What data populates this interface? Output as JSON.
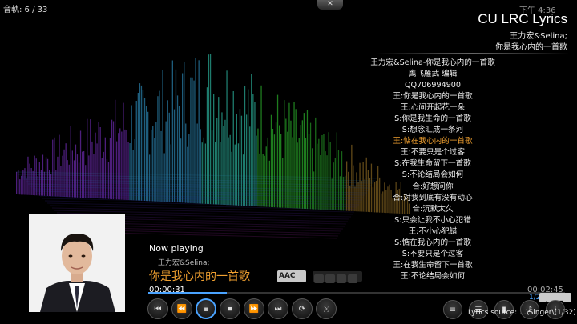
{
  "player": {
    "track_counter": "音軌: 6 / 33",
    "clock": "下午 4:36",
    "close_glyph": "✕"
  },
  "lyrics_panel": {
    "title": "CU LRC Lyrics",
    "artist": "王力宏&Selina;",
    "song": "你是我心内的一首歌",
    "lines": [
      "王力宏&Selina-你是我心内的一首歌",
      "鹰飞雁武 编辑",
      "QQ706994900",
      "王:你是我心内的一首歌",
      "王:心间开起花一朵",
      "S:你是我生命的一首歌",
      "S:想念汇成一条河",
      "王:惦在我心内的一首歌",
      "王:不要只是个过客",
      "S:在我生命留下一首歌",
      "S:不论结局会如何",
      "合:好想问你",
      "合:对我到底有没有动心",
      "合:沉默太久",
      "S:只会让我不小心犯错",
      "王:不小心犯错",
      "S:惦在我心内的一首歌",
      "S:不要只是个过客",
      "王:在我生命留下一首歌",
      "王:不论结局会如何"
    ],
    "active_index": 7,
    "source_label": "Lyrics source: ...\\Singer\\(1/32)"
  },
  "now_playing": {
    "label": "Now playing",
    "artist": "王力宏&Selina;",
    "title": "你是我心内的一首歌",
    "codec": "AAC",
    "elapsed": "00:00:31",
    "total": "00:02:45",
    "progress": 0.188,
    "page": "1/2"
  },
  "controls": {
    "prev": "⏮",
    "rewind": "⏪",
    "play_pause": "⏸",
    "stop": "⏹",
    "forward": "⏩",
    "next": "⏭",
    "repeat": "⟳",
    "shuffle": "⤨",
    "page_up": "▲",
    "page_down": "▼"
  },
  "colors": {
    "accent": "#4aa3ff",
    "highlight": "#f0a030"
  }
}
